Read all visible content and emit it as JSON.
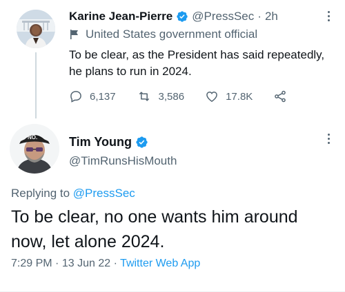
{
  "parent_tweet": {
    "display_name": "Karine Jean-Pierre",
    "handle": "@PressSec",
    "separator": "·",
    "time_ago": "2h",
    "gov_label": "United States government official",
    "text": "To be clear, as the President has said repeatedly, he plans to run in 2024.",
    "replies": "6,137",
    "retweets": "3,586",
    "likes": "17.8K"
  },
  "reply_tweet": {
    "display_name": "Tim Young",
    "handle": "@TimRunsHisMouth",
    "replying_prefix": "Replying to",
    "replying_handle": "@PressSec",
    "text": "To be clear, no one wants him around now, let alone 2024.",
    "time": "7:29 PM",
    "separator": "·",
    "date": "13 Jun 22",
    "separator2": "·",
    "source": "Twitter Web App"
  },
  "colors": {
    "text": "#0f1419",
    "secondary": "#536471",
    "accent": "#1d9bf0",
    "divider": "#cfd9de"
  },
  "icons": {
    "verified": "verified-badge-icon",
    "gov": "flag-icon",
    "reply": "reply-icon",
    "retweet": "retweet-icon",
    "like": "heart-icon",
    "share": "share-icon",
    "more": "more-icon"
  }
}
